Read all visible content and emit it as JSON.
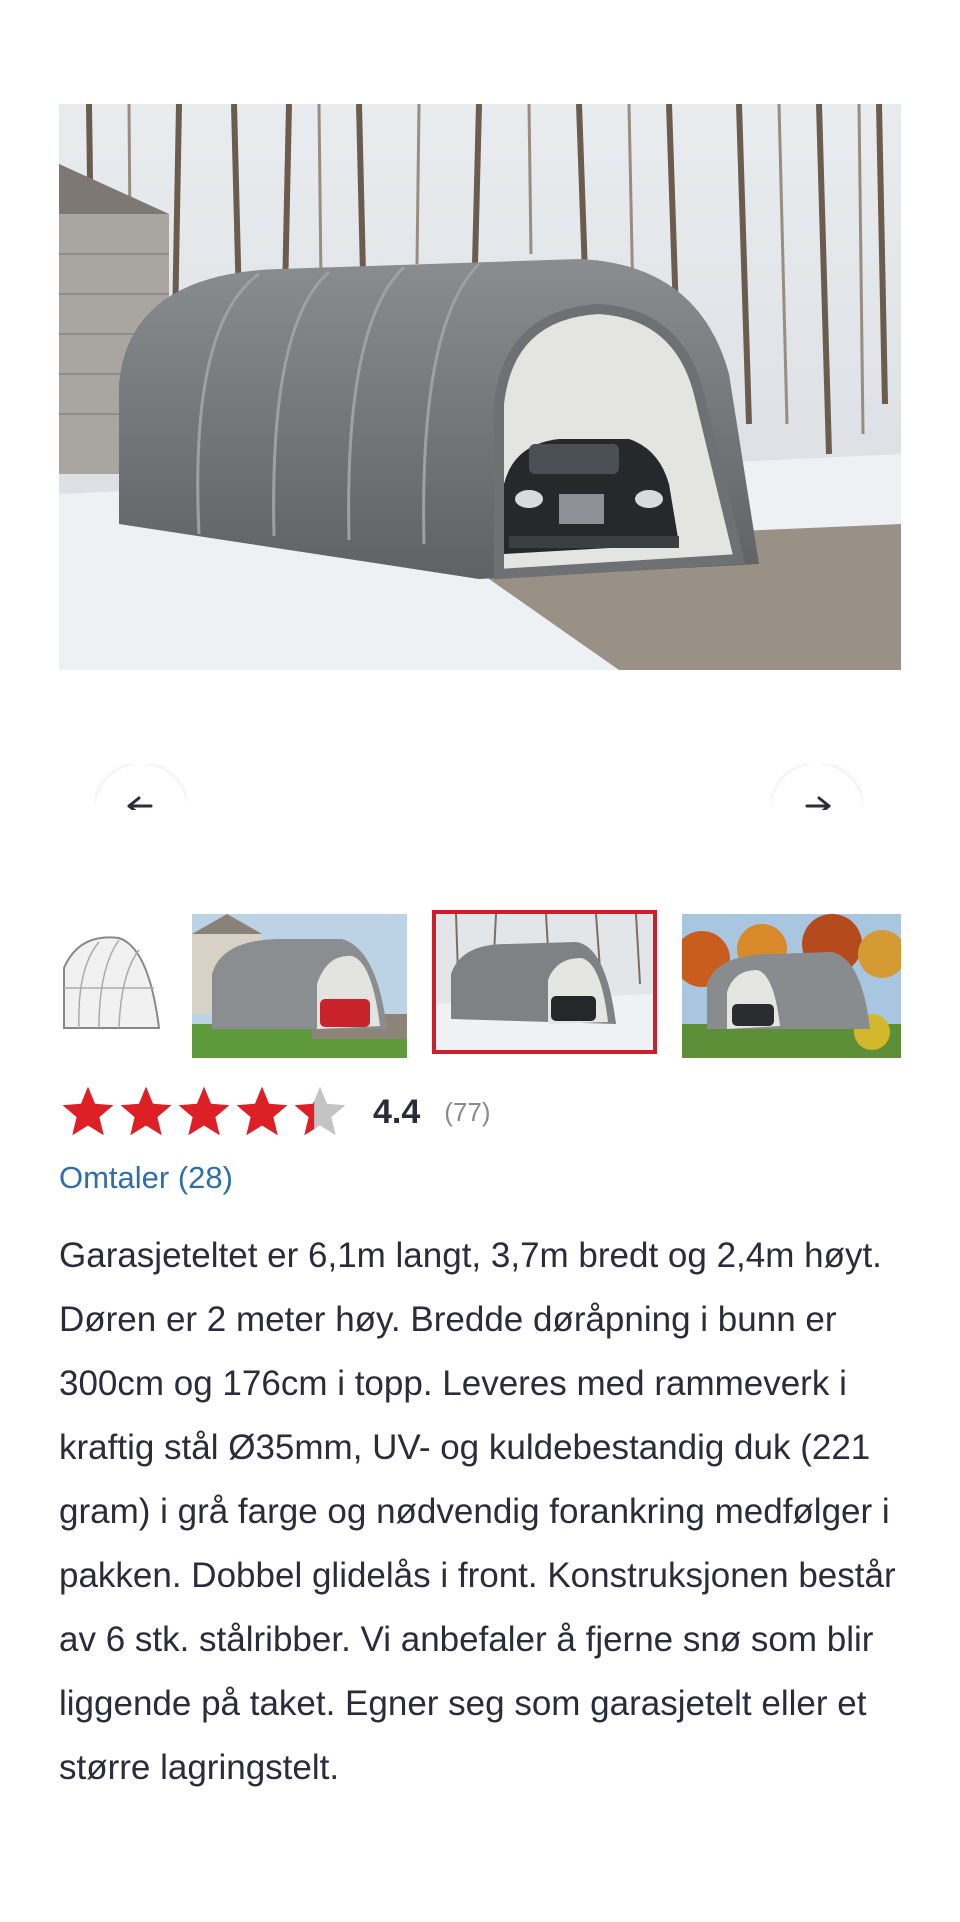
{
  "product": {
    "main_image_alt": "Garasjetelt",
    "carousel": {
      "prev_icon": "arrow-left-icon",
      "next_icon": "arrow-right-icon",
      "selected_index": 2,
      "thumbnail_count": 4
    },
    "rating": {
      "value": 4.4,
      "value_label": "4.4",
      "count_label": "(77)",
      "max": 5,
      "star_color": "#dd1f26",
      "empty_star_color": "#c4c4c4"
    },
    "reviews_link": "Omtaler (28)",
    "description": "Garasjeteltet er 6,1m langt, 3,7m bredt og 2,4m høyt. Døren er 2 meter høy. Bredde døråpning i bunn er 300cm og 176cm i topp. Leveres med rammeverk i kraftig stål Ø35mm, UV- og kuldebestandig duk (221 gram) i grå farge og nødvendig forankring medfølger i pakken. Dobbel glidelås i front. Konstruksjonen består av 6 stk. stålribber. Vi anbefaler å fjerne snø som blir liggende på taket. Egner seg som garasjetelt eller et større lagringstelt."
  },
  "colors": {
    "accent_red": "#cc1f2c",
    "link_blue": "#2e6fa8",
    "text": "#2b2b3a"
  }
}
